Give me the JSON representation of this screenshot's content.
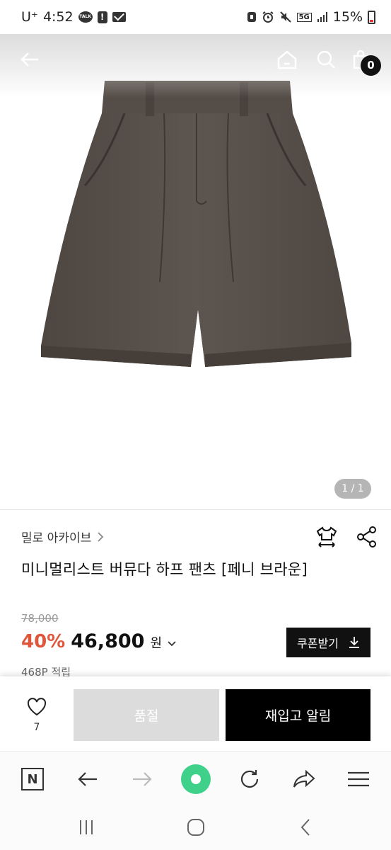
{
  "status_bar": {
    "carrier": "U⁺",
    "time": "4:52",
    "talk_label": "TALK",
    "network": "5G",
    "battery": "15%"
  },
  "header": {
    "cart_count": "0"
  },
  "gallery": {
    "pager": "1 / 1"
  },
  "product": {
    "brand": "밀로 아카이브",
    "title": "미니멀리스트 버뮤다 하프 팬츠 [페니 브라운]",
    "original_price": "78,000",
    "discount": "40%",
    "price": "46,800",
    "currency": "원",
    "coupon_label": "쿠폰받기",
    "points": "468P 적립"
  },
  "actions": {
    "like_count": "7",
    "soldout_label": "품절",
    "restock_label": "재입고 알림"
  },
  "colors": {
    "discount": "#e0563a",
    "fabric": "#5a524c",
    "browser_accent": "#3fd18a"
  }
}
